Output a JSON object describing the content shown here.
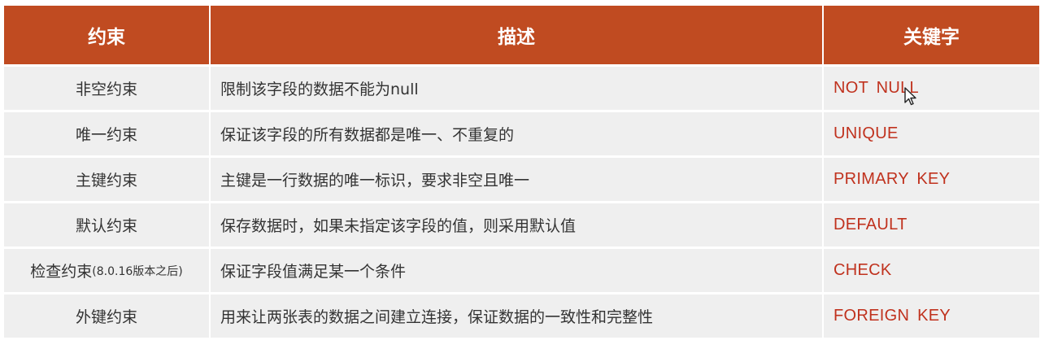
{
  "header": {
    "col1": "约束",
    "col2": "描述",
    "col3": "关键字"
  },
  "rows": [
    {
      "constraint": "非空约束",
      "constraint_note": "",
      "description": "限制该字段的数据不能为null",
      "keyword": "NOT NULL"
    },
    {
      "constraint": "唯一约束",
      "constraint_note": "",
      "description": "保证该字段的所有数据都是唯一、不重复的",
      "keyword": "UNIQUE"
    },
    {
      "constraint": "主键约束",
      "constraint_note": "",
      "description": "主键是一行数据的唯一标识，要求非空且唯一",
      "keyword": "PRIMARY KEY"
    },
    {
      "constraint": "默认约束",
      "constraint_note": "",
      "description": "保存数据时，如果未指定该字段的值，则采用默认值",
      "keyword": "DEFAULT"
    },
    {
      "constraint": "检查约束",
      "constraint_note": "(8.0.16版本之后)",
      "description": "保证字段值满足某一个条件",
      "keyword": "CHECK"
    },
    {
      "constraint": "外键约束",
      "constraint_note": "",
      "description": "用来让两张表的数据之间建立连接，保证数据的一致性和完整性",
      "keyword": "FOREIGN KEY"
    }
  ],
  "colors": {
    "header_bg": "#c04b21",
    "row_bg": "#efefef",
    "keyword_text": "#c0321e"
  },
  "icons": {
    "cursor": "mouse-pointer-icon"
  }
}
